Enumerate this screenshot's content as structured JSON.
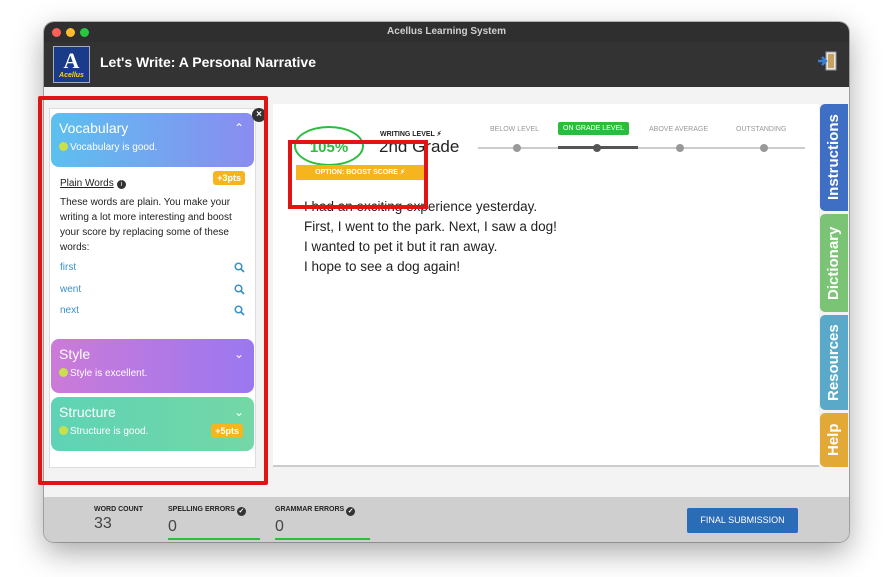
{
  "window": {
    "title": "Acellus Learning System"
  },
  "header": {
    "logo_text": "Acellus",
    "logo_letter": "A",
    "lesson_title": "Let's Write: A Personal Narrative"
  },
  "feedback": {
    "vocabulary": {
      "title": "Vocabulary",
      "status": "Vocabulary is good.",
      "item_heading": "Plain Words",
      "points": "+3pts",
      "description": "These words are plain.  You make your writing a lot more interesting and boost your score by replacing some of these words:",
      "words": [
        "first",
        "went",
        "next"
      ]
    },
    "style": {
      "title": "Style",
      "status": "Style is excellent."
    },
    "structure": {
      "title": "Structure",
      "status": "Structure is good.",
      "points": "+5pts"
    }
  },
  "scoring": {
    "percent": "105%",
    "writing_level_label": "WRITING LEVEL",
    "grade": "2nd Grade",
    "levels": [
      "BELOW LEVEL",
      "ON GRADE LEVEL",
      "ABOVE AVERAGE",
      "OUTSTANDING"
    ],
    "current_level_index": 1,
    "boost_button": "OPTION: BOOST SCORE"
  },
  "essay": {
    "lines": [
      "I had an exciting experience yesterday.",
      "First, I went to the park. Next, I saw a dog!",
      "I wanted to pet it but it ran away.",
      "I hope to see a dog again!"
    ]
  },
  "side_tabs": [
    "Instructions",
    "Dictionary",
    "Resources",
    "Help"
  ],
  "stats": {
    "word_count_label": "WORD COUNT",
    "word_count": "33",
    "spelling_label": "SPELLING ERRORS",
    "spelling_errors": "0",
    "grammar_label": "GRAMMAR ERRORS",
    "grammar_errors": "0"
  },
  "submit_label": "FINAL SUBMISSION",
  "colors": {
    "accent_green": "#2dbd3e",
    "boost_orange": "#f6b51e",
    "submit_blue": "#2a6cb5",
    "annotation_red": "#e01414"
  }
}
